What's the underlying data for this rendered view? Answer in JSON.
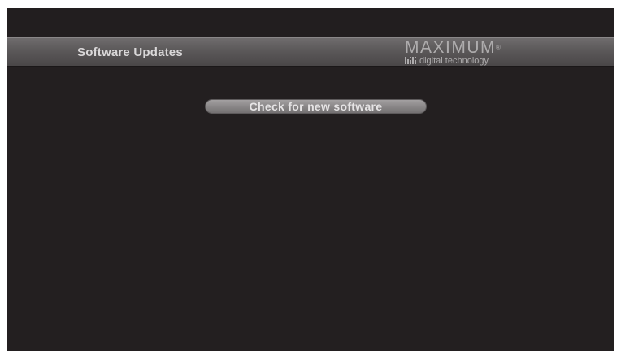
{
  "header": {
    "title": "Software Updates",
    "brand_name": "MAXIMUM",
    "brand_reg": "®",
    "brand_tagline": "digital technology"
  },
  "menu": {
    "check_button_label": "Check for new software"
  },
  "colors": {
    "background": "#231f20",
    "header_bar": "#5b5859",
    "button": "#8a8788",
    "text": "#d9d7d8"
  }
}
